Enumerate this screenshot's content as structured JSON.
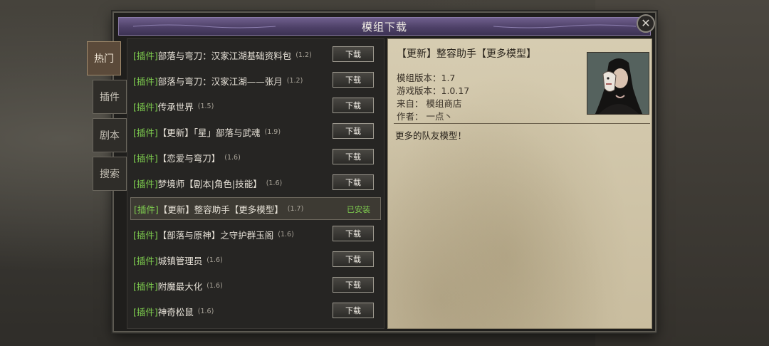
{
  "window": {
    "title": "模组下载"
  },
  "tabs": [
    {
      "label": "热门",
      "active": true
    },
    {
      "label": "插件",
      "active": false
    },
    {
      "label": "剧本",
      "active": false
    },
    {
      "label": "搜索",
      "active": false
    }
  ],
  "mods": [
    {
      "tag": "[插件]",
      "name": "部落与弯刀：汉家江湖基础资料包",
      "version": "(1.2)",
      "action": "下载"
    },
    {
      "tag": "[插件]",
      "name": "部落与弯刀：汉家江湖——张月",
      "version": "(1.2)",
      "action": "下载"
    },
    {
      "tag": "[插件]",
      "name": "传承世界",
      "version": "(1.5)",
      "action": "下载"
    },
    {
      "tag": "[插件]",
      "name": "【更新】「星」部落与武魂",
      "version": "(1.9)",
      "action": "下载"
    },
    {
      "tag": "[插件]",
      "name": "【恋爱与弯刀】",
      "version": "(1.6)",
      "action": "下载"
    },
    {
      "tag": "[插件]",
      "name": "梦境师【剧本|角色|技能】",
      "version": "(1.6)",
      "action": "下载"
    },
    {
      "tag": "[插件]",
      "name": "【更新】整容助手【更多模型】",
      "version": "(1.7)",
      "action": "已安装",
      "selected": true
    },
    {
      "tag": "[插件]",
      "name": "【部落与原神】之守护群玉阁",
      "version": "(1.6)",
      "action": "下载"
    },
    {
      "tag": "[插件]",
      "name": "城镇管理员",
      "version": "(1.6)",
      "action": "下载"
    },
    {
      "tag": "[插件]",
      "name": "附魔最大化",
      "version": "(1.6)",
      "action": "下载"
    },
    {
      "tag": "[插件]",
      "name": "神奇松鼠",
      "version": "(1.6)",
      "action": "下载"
    }
  ],
  "detail": {
    "title": "【更新】整容助手【更多模型】",
    "mod_version": "模组版本：1.7",
    "game_version": "游戏版本：1.0.17",
    "source": "来自：  模组商店",
    "author": "作者：  一点丶",
    "description": "更多的队友模型！"
  },
  "colors": {
    "tag": "#7fcf4f",
    "installed": "#7fcf4f",
    "titlebar": "#4e4168"
  }
}
